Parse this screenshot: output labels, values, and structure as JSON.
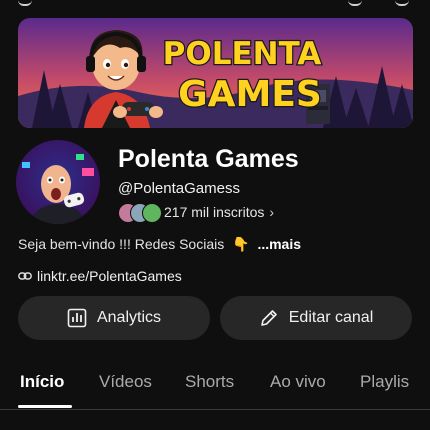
{
  "channel": {
    "name": "Polenta Games",
    "handle": "@PolentaGamess",
    "subscribers": "217 mil inscritos",
    "description": "Seja bem-vindo !!! Redes Sociais",
    "description_emoji": "👇",
    "more_label": "...mais",
    "link": "linktr.ee/PolentaGames"
  },
  "banner": {
    "line1": "POLENTA",
    "line2": "GAMES"
  },
  "actions": {
    "analytics_label": "Analytics",
    "edit_label": "Editar canal"
  },
  "tabs": [
    {
      "label": "Início",
      "active": true
    },
    {
      "label": "Vídeos",
      "active": false
    },
    {
      "label": "Shorts",
      "active": false
    },
    {
      "label": "Ao vivo",
      "active": false
    },
    {
      "label": "Playlis",
      "active": false
    }
  ],
  "colors": {
    "background": "#0f0f0f",
    "button_bg": "#272727",
    "banner_title": "#ffd21f",
    "banner_sky_top": "#5a2a8c",
    "banner_sky_bottom": "#f2734a"
  },
  "icons": {
    "subscribers_chevron": "chevron-right-icon",
    "link": "link-icon",
    "analytics": "bar-chart-icon",
    "edit": "pencil-icon"
  }
}
